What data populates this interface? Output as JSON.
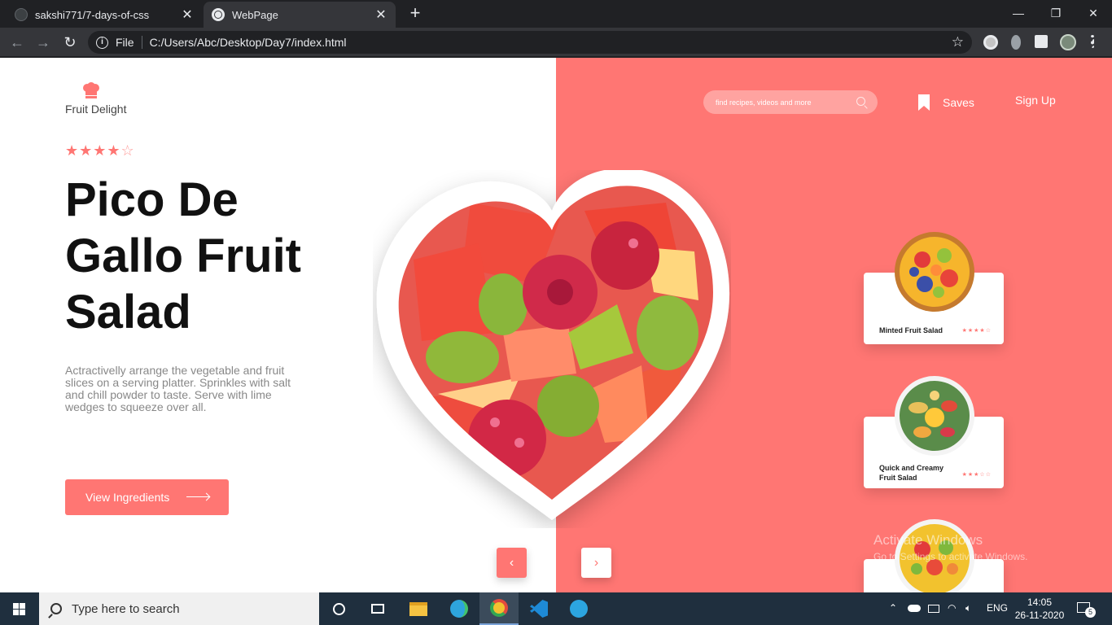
{
  "browser": {
    "tabs": [
      {
        "title": "sakshi771/7-days-of-css",
        "close": "✕"
      },
      {
        "title": "WebPage",
        "close": "✕"
      }
    ],
    "new_tab": "+",
    "window_controls": {
      "minimize": "—",
      "restore": "❐",
      "close": "✕"
    },
    "nav": {
      "back": "←",
      "forward": "→",
      "reload": "↻"
    },
    "address": {
      "info": "i",
      "scheme": "File",
      "url": "C:/Users/Abc/Desktop/Day7/index.html",
      "bookmark": "☆"
    }
  },
  "page": {
    "brand": "Fruit Delight",
    "rating": {
      "filled": "★★★★",
      "empty": "☆",
      "value": 4,
      "max": 5
    },
    "title_lines": [
      "Pico De",
      "Gallo Fruit",
      "Salad"
    ],
    "description": "Actractivelly arrange the vegetable and fruit slices on a serving platter. Sprinkles with salt and chill powder to taste. Serve with lime wedges to squeeze over all.",
    "cta_label": "View Ingredients",
    "search_placeholder": "find recipes, videos and more",
    "saves_label": "Saves",
    "signup_label": "Sign Up",
    "slider": {
      "prev": "‹",
      "next": "›"
    },
    "cards": [
      {
        "title": "Minted Fruit Salad",
        "stars": "★★★★☆",
        "rating": 3.5
      },
      {
        "title": "Quick and Creamy Fruit Salad",
        "stars": "★★★☆☆",
        "rating": 3
      },
      {
        "title": "",
        "stars": "",
        "rating": null
      }
    ],
    "watermark": {
      "line1": "Activate Windows",
      "line2": "Go to Settings to activate Windows."
    },
    "colors": {
      "accent": "#ff7673",
      "accent_light": "#ffa3a0",
      "text_dark": "#111111",
      "text_muted": "#888888"
    }
  },
  "taskbar": {
    "search_label": "Type here to search",
    "apps": [
      "task-view",
      "file-explorer",
      "edge",
      "chrome",
      "vscode",
      "telegram"
    ],
    "language": "ENG",
    "time": "14:05",
    "date": "26-11-2020",
    "notification_count": "5"
  }
}
